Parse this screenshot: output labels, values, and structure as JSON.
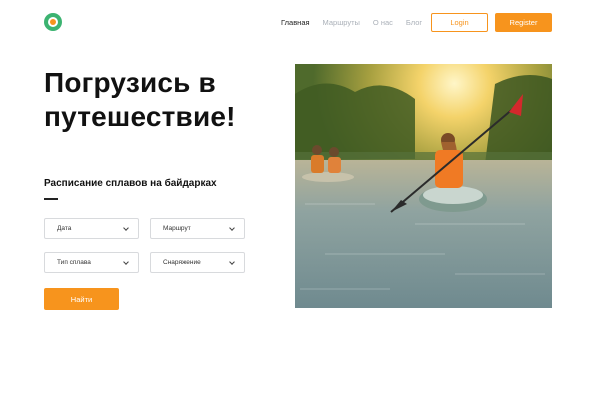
{
  "header": {
    "logo": "logo-icon",
    "nav": [
      "Главная",
      "Маршруты",
      "О нас",
      "Блог"
    ],
    "login_label": "Login",
    "register_label": "Register"
  },
  "hero": {
    "title_line1": "Погрузись в",
    "title_line2": "путешествие!",
    "image": "kayaking-photo"
  },
  "schedule": {
    "title": "Расписание сплавов на байдарках",
    "fields": {
      "date": "Дата",
      "route": "Маршрут",
      "type": "Тип сплава",
      "gear": "Снаряжение"
    },
    "search_label": "Найти"
  },
  "colors": {
    "accent": "#f7941d",
    "logo_green": "#3cb371",
    "nav_muted": "#aab0b8"
  }
}
